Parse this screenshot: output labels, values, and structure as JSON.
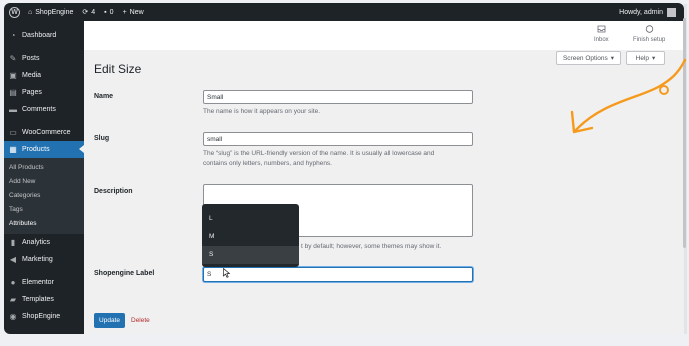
{
  "admin_bar": {
    "site_name": "ShopEngine",
    "updates_count": "4",
    "comments_count": "0",
    "new_label": "New",
    "greeting": "Howdy, admin"
  },
  "sidebar": {
    "dashboard": "Dashboard",
    "posts": "Posts",
    "media": "Media",
    "pages": "Pages",
    "comments": "Comments",
    "woocommerce": "WooCommerce",
    "products": "Products",
    "submenu": {
      "all_products": "All Products",
      "add_new": "Add New",
      "categories": "Categories",
      "tags": "Tags",
      "attributes": "Attributes"
    },
    "analytics": "Analytics",
    "marketing": "Marketing",
    "elementor": "Elementor",
    "templates": "Templates",
    "shopengine": "ShopEngine"
  },
  "toolbar": {
    "inbox": "Inbox",
    "finish_setup": "Finish setup",
    "screen_options": "Screen Options",
    "help": "Help"
  },
  "page": {
    "title": "Edit Size",
    "name_label": "Name",
    "name_value": "Small",
    "name_help": "The name is how it appears on your site.",
    "slug_label": "Slug",
    "slug_value": "small",
    "slug_help_line1": "The “slug” is the URL-friendly version of the name. It is usually all lowercase and",
    "slug_help_line2": "contains only letters, numbers, and hyphens.",
    "description_label": "Description",
    "description_help_visible": "t by default; however, some themes may show it.",
    "shopengine_label": "Shopengine Label",
    "shopengine_value": "S",
    "update_button": "Update",
    "delete_link": "Delete"
  },
  "autocomplete": {
    "options": [
      "L",
      "M",
      "S"
    ],
    "highlighted": "S"
  },
  "colors": {
    "admin_dark": "#1d2327",
    "accent_blue": "#2271b1",
    "annotation_orange": "#f59a1c",
    "delete_red": "#b32d2e"
  }
}
